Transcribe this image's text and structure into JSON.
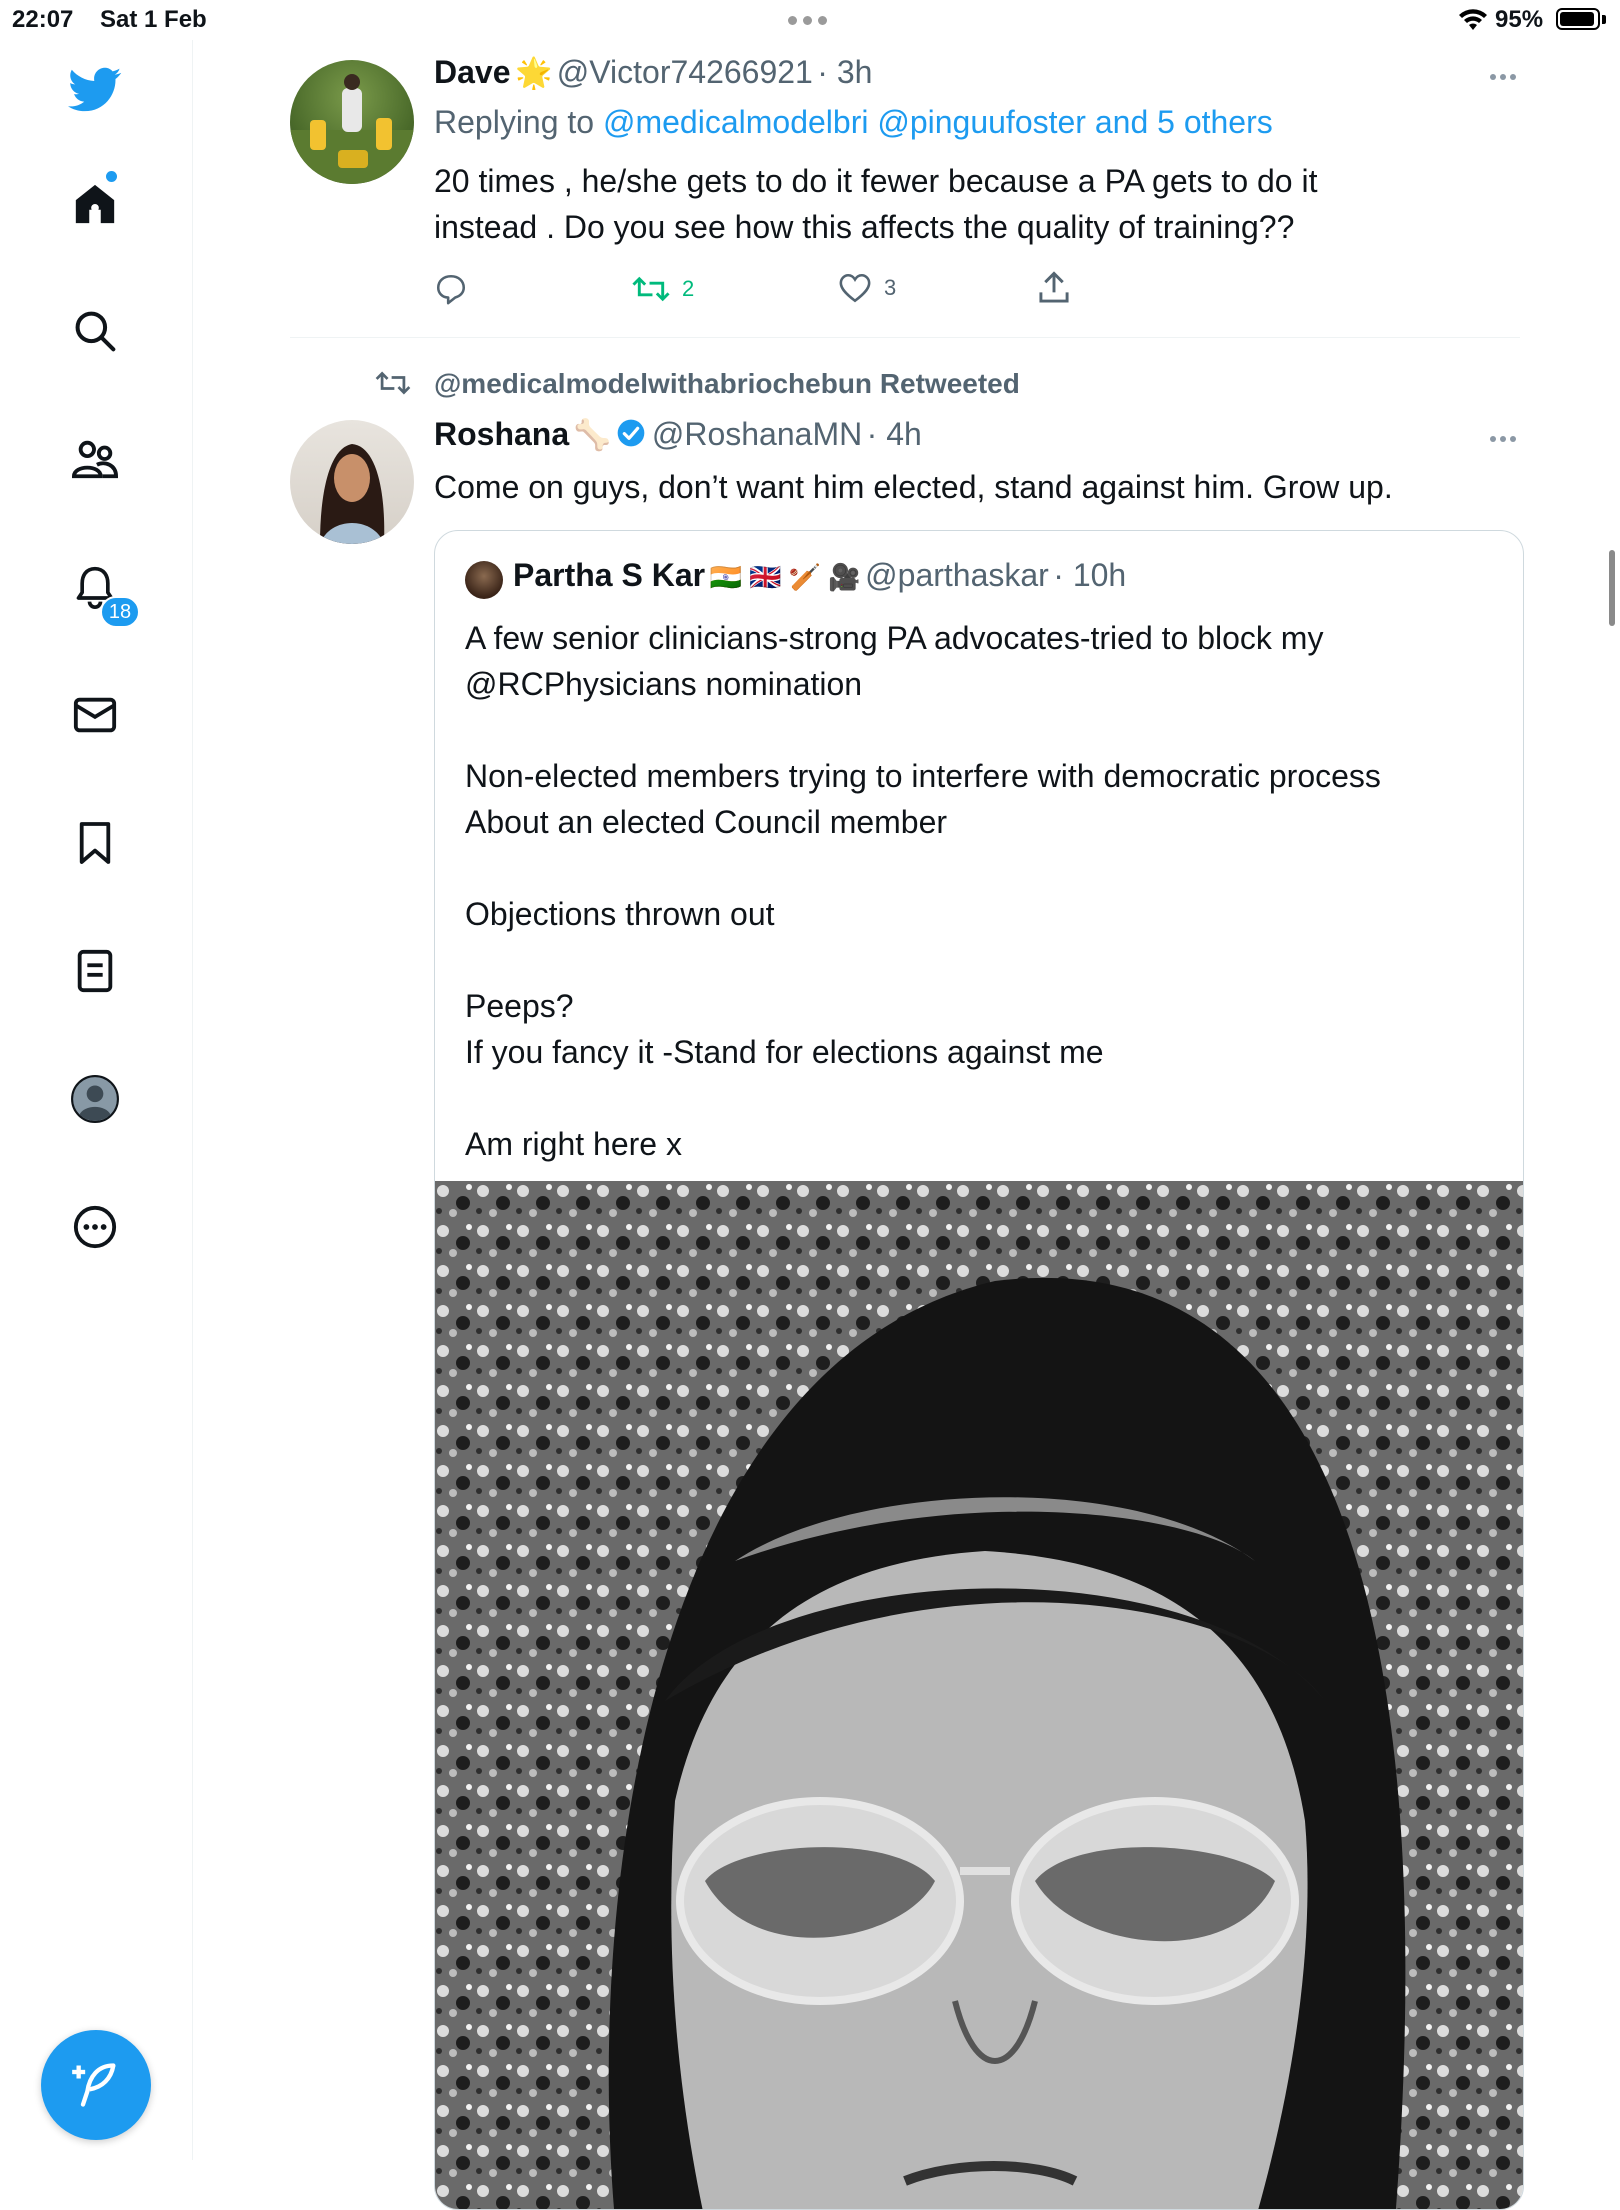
{
  "status_bar": {
    "time": "22:07",
    "date": "Sat 1 Feb",
    "battery": "95%"
  },
  "sidebar": {
    "items": [
      {
        "name": "home",
        "icon": "home-icon"
      },
      {
        "name": "explore",
        "icon": "search-icon"
      },
      {
        "name": "communities",
        "icon": "communities-icon"
      },
      {
        "name": "notifications",
        "icon": "bell-icon"
      },
      {
        "name": "messages",
        "icon": "mail-icon"
      },
      {
        "name": "bookmarks",
        "icon": "bookmark-icon"
      },
      {
        "name": "lists",
        "icon": "list-icon"
      },
      {
        "name": "profile",
        "icon": "profile-icon"
      },
      {
        "name": "more",
        "icon": "more-icon"
      }
    ],
    "notification_count": "18"
  },
  "tweet1": {
    "name": "Dave",
    "emoji": "🌟",
    "handle": "@Victor74266921",
    "time": "· 3h",
    "replying_label": "Replying to",
    "replying_to": "@medicalmodelbri @pinguufoster and 5 others",
    "text_line1": "20 times , he/she gets to do it fewer because a PA gets to do it",
    "text_line2": "instead . Do you see how this affects the quality of training??",
    "retweets": "2",
    "likes": "3"
  },
  "tweet2": {
    "retweeted_by": "@medicalmodelwithabriochebun Retweeted",
    "name": "Roshana",
    "emoji": "🦴",
    "handle": "@RoshanaMN",
    "time": "· 4h",
    "text": "Come on guys, don’t want him elected, stand against him. Grow up.",
    "quote": {
      "name": "Partha S Kar",
      "emojis": "🇮🇳 🇬🇧 🏏 🎥",
      "handle": "@parthaskar",
      "time": "· 10h",
      "lines": [
        "A few senior clinicians-strong PA advocates-tried to block my",
        "@RCPhysicians nomination",
        "",
        "Non-elected members trying to interfere with  democratic process",
        "About an elected Council member",
        "",
        "Objections thrown out",
        "",
        "Peeps?",
        "If you fancy it -Stand for elections against me",
        "",
        "Am right here x"
      ]
    }
  },
  "colors": {
    "accent": "#1d9bf0",
    "retweet_green": "#00ba7c",
    "muted": "#536471"
  }
}
